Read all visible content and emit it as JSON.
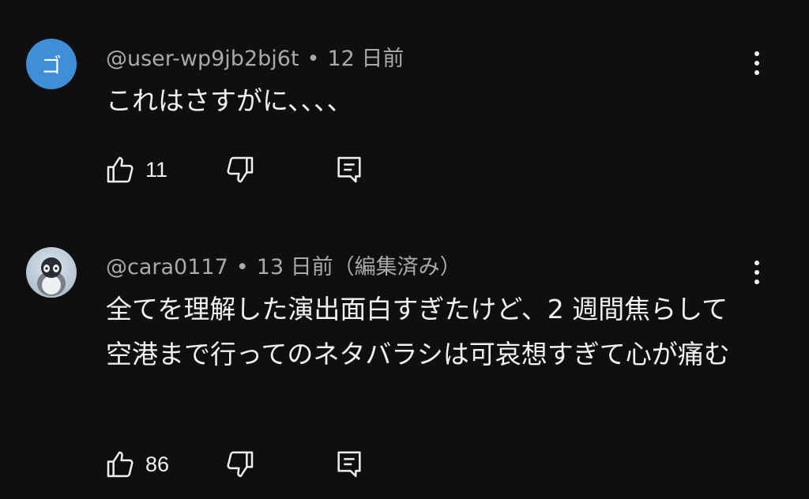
{
  "comments": [
    {
      "avatar_letter": "ゴ",
      "avatar_color": "#3e8ed8",
      "author": "@user-wp9jb2bj6t",
      "separator": "•",
      "time": "12 日前",
      "text": "これはさすがに、、、、",
      "likes": "11",
      "icons": {
        "like": "thumbs-up-icon",
        "dislike": "thumbs-down-icon",
        "reply": "reply-icon",
        "more": "more-vert-icon"
      }
    },
    {
      "avatar_description": "penguin-avatar",
      "author": "@cara0117",
      "separator": "•",
      "time": "13 日前（編集済み）",
      "text": "全てを理解した演出面白すぎたけど、2 週間焦らして空港まで行ってのネタバラシは可哀想すぎて心が痛む",
      "likes": "86",
      "icons": {
        "like": "thumbs-up-icon",
        "dislike": "thumbs-down-icon",
        "reply": "reply-icon",
        "more": "more-vert-icon"
      }
    }
  ],
  "colors": {
    "background": "#0f0f0f",
    "primary_text": "#f1f1f1",
    "secondary_text": "#aaaaaa"
  }
}
